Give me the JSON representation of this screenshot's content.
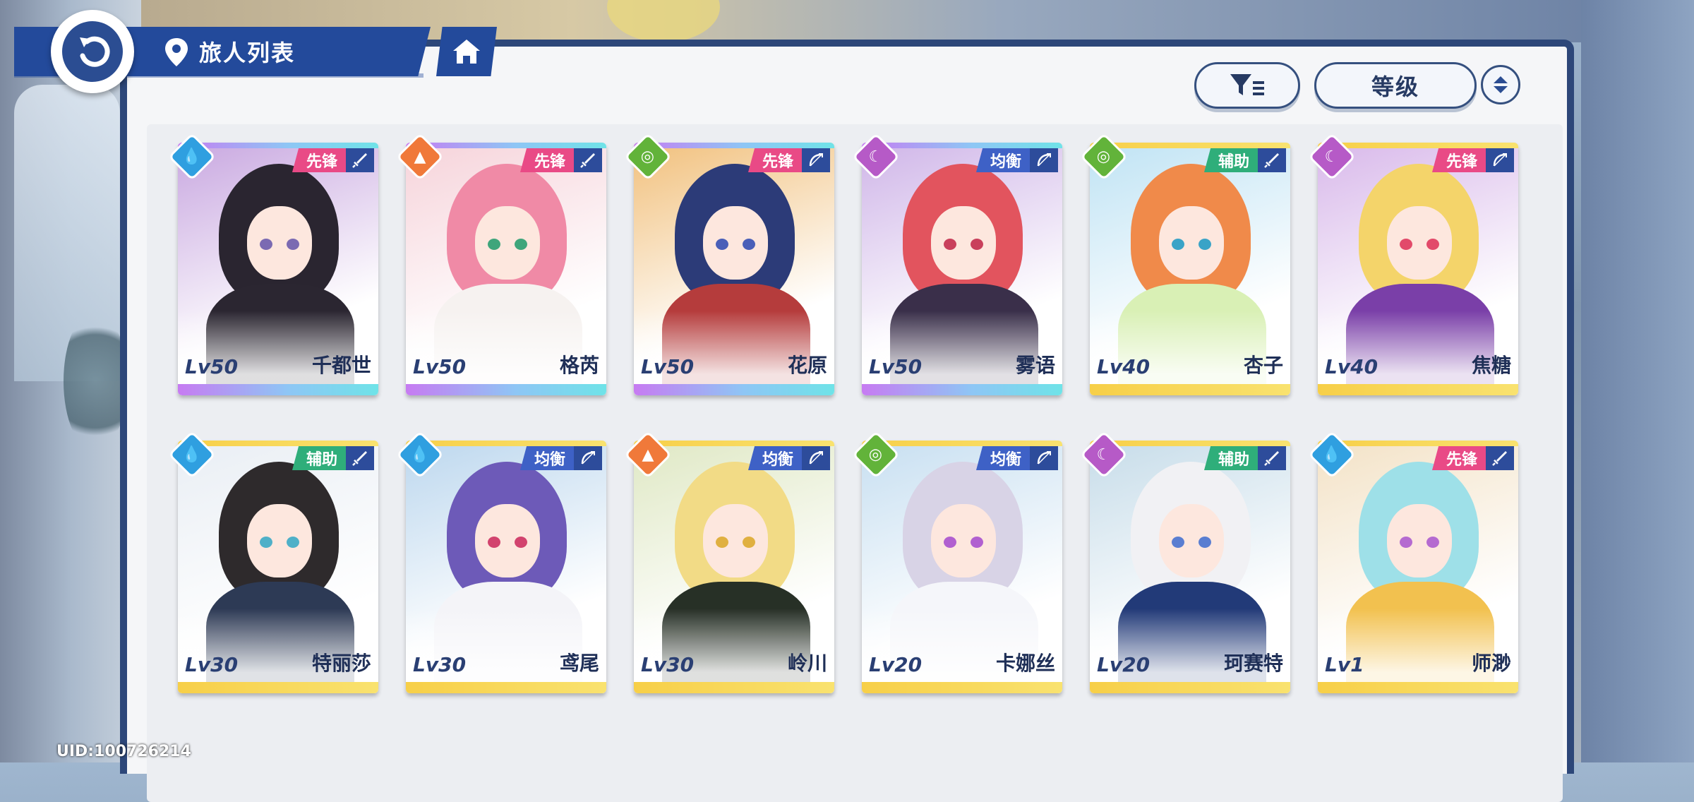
{
  "header": {
    "title": "旅人列表"
  },
  "toolbar": {
    "sort_label": "等级"
  },
  "uid": "UID:100726214",
  "colors": {
    "vanguard": "#e94a86",
    "balance": "#3e61c6",
    "support": "#2fae7a",
    "water": "#2f9fe0",
    "fire": "#f0793a",
    "wind": "#62b33a",
    "moon": "#b65ac7"
  },
  "characters": [
    {
      "name": "千都世",
      "level": "Lv50",
      "role": "先锋",
      "element": "water-icon",
      "weapon": "sword-icon",
      "rarity": "ssr"
    },
    {
      "name": "格芮",
      "level": "Lv50",
      "role": "先锋",
      "element": "fire-icon",
      "weapon": "sword-icon",
      "rarity": "ssr"
    },
    {
      "name": "花原",
      "level": "Lv50",
      "role": "先锋",
      "element": "wind-icon",
      "weapon": "bow-icon",
      "rarity": "ssr"
    },
    {
      "name": "雾语",
      "level": "Lv50",
      "role": "均衡",
      "element": "moon-icon",
      "weapon": "bow-icon",
      "rarity": "ssr"
    },
    {
      "name": "杏子",
      "level": "Lv40",
      "role": "辅助",
      "element": "wind-icon",
      "weapon": "sword-icon",
      "rarity": "sr"
    },
    {
      "name": "焦糖",
      "level": "Lv40",
      "role": "先锋",
      "element": "moon-icon",
      "weapon": "bow-icon",
      "rarity": "sr"
    },
    {
      "name": "特丽莎",
      "level": "Lv30",
      "role": "辅助",
      "element": "water-icon",
      "weapon": "sword-icon",
      "rarity": "sr"
    },
    {
      "name": "鸢尾",
      "level": "Lv30",
      "role": "均衡",
      "element": "water-icon",
      "weapon": "bow-icon",
      "rarity": "sr"
    },
    {
      "name": "岭川",
      "level": "Lv30",
      "role": "均衡",
      "element": "fire-icon",
      "weapon": "bow-icon",
      "rarity": "sr"
    },
    {
      "name": "卡娜丝",
      "level": "Lv20",
      "role": "均衡",
      "element": "wind-icon",
      "weapon": "bow-icon",
      "rarity": "sr"
    },
    {
      "name": "珂赛特",
      "level": "Lv20",
      "role": "辅助",
      "element": "moon-icon",
      "weapon": "sword-icon",
      "rarity": "sr"
    },
    {
      "name": "师渺",
      "level": "Lv1",
      "role": "先锋",
      "element": "water-icon",
      "weapon": "sword-icon",
      "rarity": "sr"
    }
  ]
}
